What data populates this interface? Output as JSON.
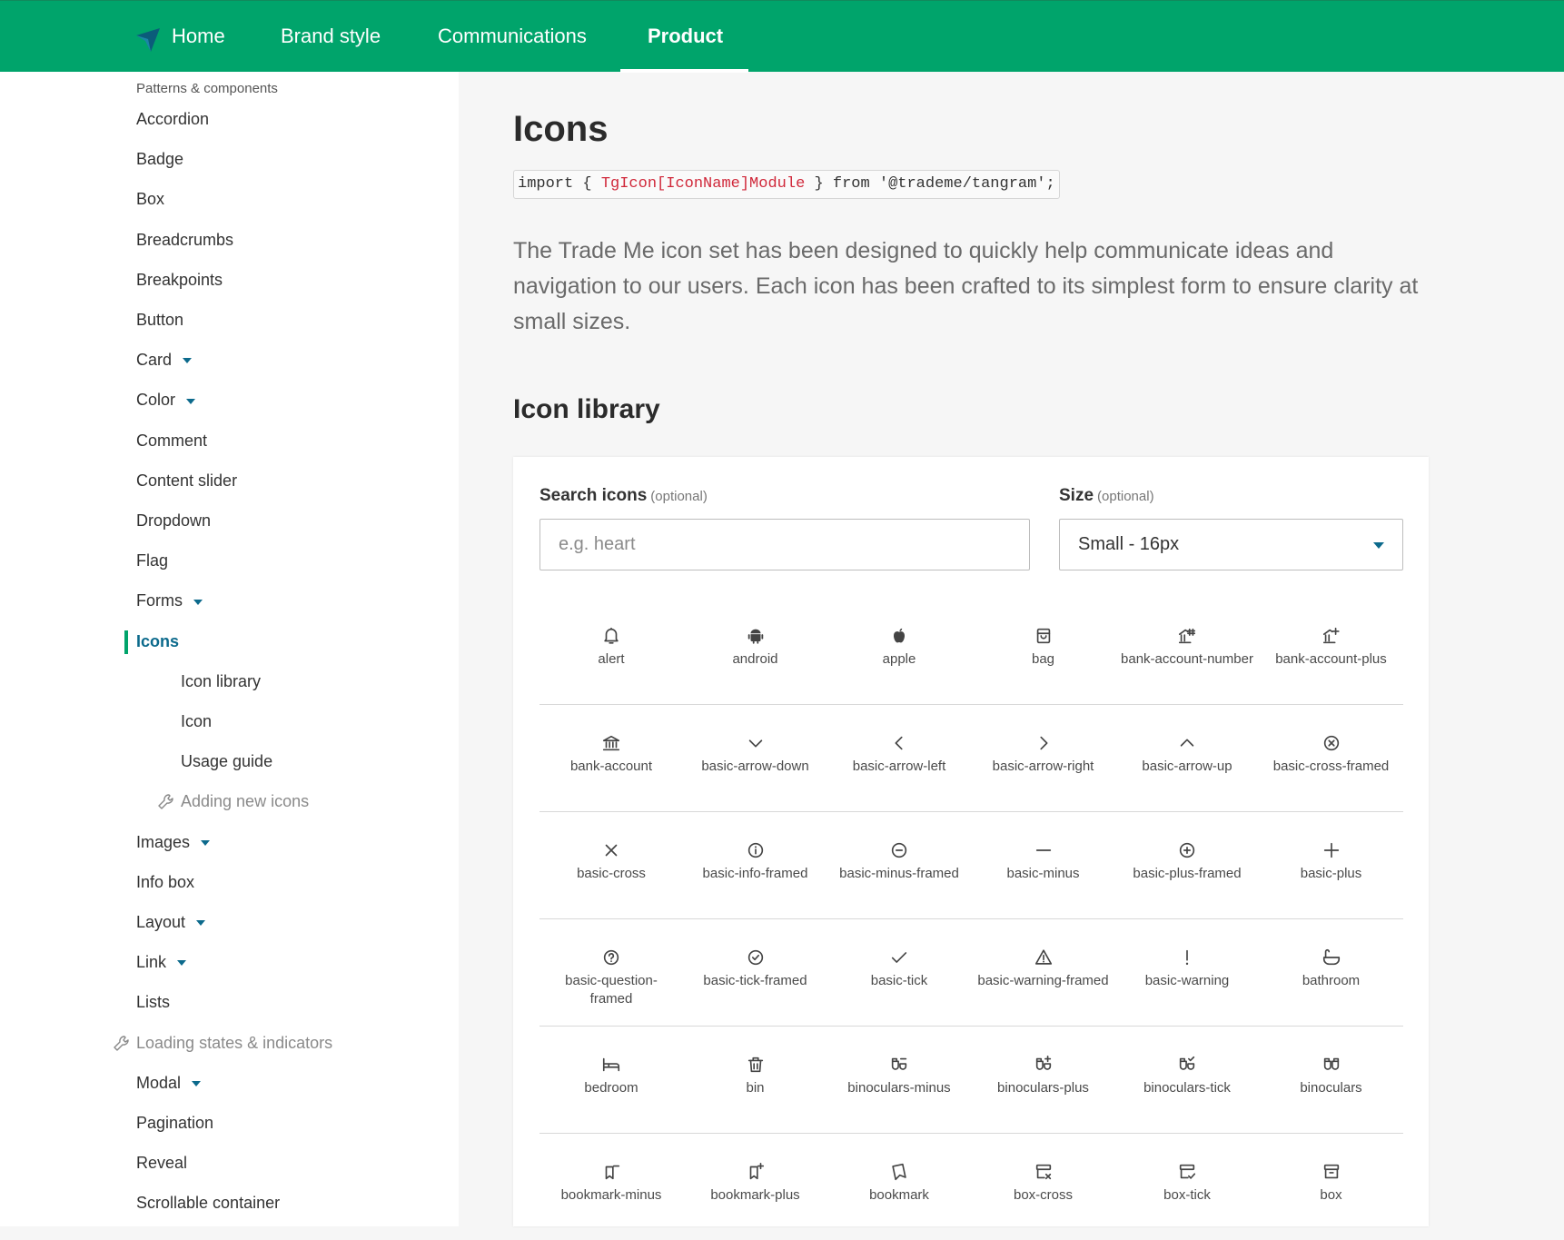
{
  "nav": {
    "items": [
      "Home",
      "Brand style",
      "Communications",
      "Product"
    ],
    "active": "Product"
  },
  "sidebar": {
    "section_label": "Patterns & components",
    "items": [
      {
        "label": "Accordion"
      },
      {
        "label": "Badge"
      },
      {
        "label": "Box"
      },
      {
        "label": "Breadcrumbs"
      },
      {
        "label": "Breakpoints"
      },
      {
        "label": "Button"
      },
      {
        "label": "Card",
        "expandable": true
      },
      {
        "label": "Color",
        "expandable": true
      },
      {
        "label": "Comment"
      },
      {
        "label": "Content slider"
      },
      {
        "label": "Dropdown"
      },
      {
        "label": "Flag"
      },
      {
        "label": "Forms",
        "expandable": true
      },
      {
        "label": "Icons",
        "active": true
      },
      {
        "label": "Icon library",
        "sub": true
      },
      {
        "label": "Icon",
        "sub": true
      },
      {
        "label": "Usage guide",
        "sub": true
      },
      {
        "label": "Adding new icons",
        "sub": true,
        "wip": true
      },
      {
        "label": "Images",
        "expandable": true
      },
      {
        "label": "Info box"
      },
      {
        "label": "Layout",
        "expandable": true
      },
      {
        "label": "Link",
        "expandable": true
      },
      {
        "label": "Lists"
      },
      {
        "label": "Loading states & indicators",
        "wip": true
      },
      {
        "label": "Modal",
        "expandable": true
      },
      {
        "label": "Pagination"
      },
      {
        "label": "Reveal"
      },
      {
        "label": "Scrollable container"
      }
    ]
  },
  "main": {
    "title": "Icons",
    "code_pre": "import { ",
    "code_highlight": "TgIcon[IconName]Module",
    "code_post": " } from '@trademe/tangram';",
    "intro": "The Trade Me icon set has been designed to quickly help communicate ideas and navigation to our users. Each icon has been crafted to its simplest form to ensure clarity at small sizes.",
    "library_heading": "Icon library"
  },
  "library": {
    "search_label": "Search icons",
    "search_optional": "(optional)",
    "search_placeholder": "e.g. heart",
    "search_value": "",
    "size_label": "Size",
    "size_optional": "(optional)",
    "size_value": "Small - 16px",
    "icons": [
      {
        "name": "alert",
        "icon": "bell-icon"
      },
      {
        "name": "android",
        "icon": "android-icon"
      },
      {
        "name": "apple",
        "icon": "apple-icon"
      },
      {
        "name": "bag",
        "icon": "bag-icon"
      },
      {
        "name": "bank-account-number",
        "icon": "bank-hash-icon"
      },
      {
        "name": "bank-account-plus",
        "icon": "bank-plus-icon"
      },
      {
        "name": "bank-account",
        "icon": "bank-icon"
      },
      {
        "name": "basic-arrow-down",
        "icon": "chevron-down-icon"
      },
      {
        "name": "basic-arrow-left",
        "icon": "chevron-left-icon"
      },
      {
        "name": "basic-arrow-right",
        "icon": "chevron-right-icon"
      },
      {
        "name": "basic-arrow-up",
        "icon": "chevron-up-icon"
      },
      {
        "name": "basic-cross-framed",
        "icon": "cross-circle-icon"
      },
      {
        "name": "basic-cross",
        "icon": "cross-icon"
      },
      {
        "name": "basic-info-framed",
        "icon": "info-circle-icon"
      },
      {
        "name": "basic-minus-framed",
        "icon": "minus-circle-icon"
      },
      {
        "name": "basic-minus",
        "icon": "minus-icon"
      },
      {
        "name": "basic-plus-framed",
        "icon": "plus-circle-icon"
      },
      {
        "name": "basic-plus",
        "icon": "plus-icon"
      },
      {
        "name": "basic-question-framed",
        "icon": "question-circle-icon"
      },
      {
        "name": "basic-tick-framed",
        "icon": "tick-circle-icon"
      },
      {
        "name": "basic-tick",
        "icon": "tick-icon"
      },
      {
        "name": "basic-warning-framed",
        "icon": "warning-triangle-icon"
      },
      {
        "name": "basic-warning",
        "icon": "exclamation-icon"
      },
      {
        "name": "bathroom",
        "icon": "bath-icon"
      },
      {
        "name": "bedroom",
        "icon": "bed-icon"
      },
      {
        "name": "bin",
        "icon": "bin-icon"
      },
      {
        "name": "binoculars-minus",
        "icon": "binoculars-minus-icon"
      },
      {
        "name": "binoculars-plus",
        "icon": "binoculars-plus-icon"
      },
      {
        "name": "binoculars-tick",
        "icon": "binoculars-tick-icon"
      },
      {
        "name": "binoculars",
        "icon": "binoculars-icon"
      },
      {
        "name": "bookmark-minus",
        "icon": "bookmark-minus-icon"
      },
      {
        "name": "bookmark-plus",
        "icon": "bookmark-plus-icon"
      },
      {
        "name": "bookmark",
        "icon": "bookmark-icon"
      },
      {
        "name": "box-cross",
        "icon": "box-cross-icon"
      },
      {
        "name": "box-tick",
        "icon": "box-tick-icon"
      },
      {
        "name": "box",
        "icon": "box-icon"
      }
    ]
  },
  "colors": {
    "brand_green": "#00a46b",
    "link_blue": "#0c6a8c",
    "code_red": "#d0283a"
  }
}
